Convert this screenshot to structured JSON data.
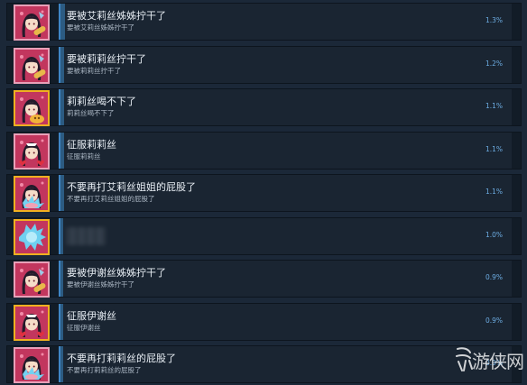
{
  "achievements": [
    {
      "title": "要被艾莉丝姊姊拧干了",
      "description": "要被艾莉丝姊姊拧干了",
      "percent": "1.3%",
      "progress": 1.3,
      "icon": "achievement-icon-girl-dark-hair-pink",
      "frame_color": "#e8a0b8",
      "bg_color": "#c2365e"
    },
    {
      "title": "要被莉莉丝拧干了",
      "description": "要被莉莉丝拧干了",
      "percent": "1.2%",
      "progress": 1.2,
      "icon": "achievement-icon-girl-dark-hair-pink",
      "frame_color": "#e8a0b8",
      "bg_color": "#c2365e"
    },
    {
      "title": "莉莉丝喝不下了",
      "description": "莉莉丝喝不下了",
      "percent": "1.1%",
      "progress": 1.1,
      "icon": "achievement-icon-girl-gold",
      "frame_color": "#f0b020",
      "bg_color": "#c2365e"
    },
    {
      "title": "征服莉莉丝",
      "description": "征服莉莉丝",
      "percent": "1.1%",
      "progress": 1.1,
      "icon": "achievement-icon-maid-hearts",
      "frame_color": "#e8a0b8",
      "bg_color": "#c2365e"
    },
    {
      "title": "不要再打艾莉丝姐姐的屁股了",
      "description": "不要再打艾莉丝姐姐的屁股了",
      "percent": "1.1%",
      "progress": 1.1,
      "icon": "achievement-icon-girl-splash",
      "frame_color": "#f0b020",
      "bg_color": "#c2365e"
    },
    {
      "title": "",
      "description": "",
      "percent": "1.0%",
      "progress": 1.0,
      "icon": "achievement-icon-splash-hidden",
      "frame_color": "#f0b020",
      "bg_color": "#c2365e",
      "hidden": true
    },
    {
      "title": "要被伊谢丝姊姊拧干了",
      "description": "要被伊谢丝姊姊拧干了",
      "percent": "0.9%",
      "progress": 0.9,
      "icon": "achievement-icon-girl-dark-hair-pink",
      "frame_color": "#e8a0b8",
      "bg_color": "#c2365e"
    },
    {
      "title": "征服伊谢丝",
      "description": "征服伊谢丝",
      "percent": "0.9%",
      "progress": 0.9,
      "icon": "achievement-icon-maid-hearts",
      "frame_color": "#f0b020",
      "bg_color": "#c2365e"
    },
    {
      "title": "不要再打莉莉丝的屁股了",
      "description": "不要再打莉莉丝的屁股了",
      "percent": "0.9%",
      "progress": 0.9,
      "icon": "achievement-icon-girl-splash",
      "frame_color": "#e8a0b8",
      "bg_color": "#c2365e"
    }
  ],
  "colors": {
    "page_bg": "#1b2838",
    "row_bg": "#121c27",
    "bar_fill": "#2c5b82",
    "percent_text": "#6dade3"
  },
  "watermark": {
    "text": "游侠网"
  }
}
